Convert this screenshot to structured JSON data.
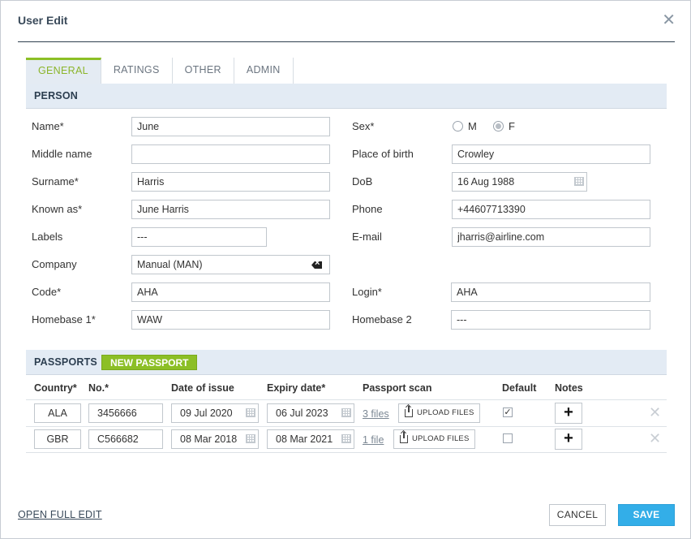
{
  "dialog": {
    "title": "User Edit",
    "close": "✕"
  },
  "tabs": [
    "GENERAL",
    "RATINGS",
    "OTHER",
    "ADMIN"
  ],
  "person": {
    "section": "PERSON",
    "left": [
      {
        "label": "Name*",
        "value": "June"
      },
      {
        "label": "Middle name",
        "value": ""
      },
      {
        "label": "Surname*",
        "value": "Harris"
      },
      {
        "label": "Known as*",
        "value": "June Harris"
      },
      {
        "label": "Labels",
        "value": "---"
      },
      {
        "label": "Company",
        "value": "Manual (MAN)"
      },
      {
        "label": "Code*",
        "value": "AHA"
      },
      {
        "label": "Homebase 1*",
        "value": "WAW"
      }
    ],
    "sex": {
      "label": "Sex*",
      "options": [
        "M",
        "F"
      ],
      "selected": "F"
    },
    "right": [
      {
        "label": "Place of birth",
        "value": "Crowley"
      },
      {
        "label": "DoB",
        "value": "16 Aug 1988"
      },
      {
        "label": "Phone",
        "value": "+44607713390"
      },
      {
        "label": "E-mail",
        "value": "jharris@airline.com"
      },
      {
        "label": "Login*",
        "value": "AHA"
      },
      {
        "label": "Homebase 2",
        "value": "---"
      }
    ]
  },
  "passports": {
    "section": "PASSPORTS",
    "new_button": "NEW PASSPORT",
    "columns": [
      "Country*",
      "No.*",
      "Date of issue",
      "Expiry date*",
      "Passport scan",
      "Default",
      "Notes"
    ],
    "rows": [
      {
        "country": "ALA",
        "number": "3456666",
        "issue": "09 Jul 2020",
        "expiry": "06 Jul 2023",
        "files": "3 files",
        "upload": "UPLOAD FILES",
        "default": true
      },
      {
        "country": "GBR",
        "number": "C566682",
        "issue": "08 Mar 2018",
        "expiry": "08 Mar 2021",
        "files": "1 file",
        "upload": "UPLOAD FILES",
        "default": false
      }
    ],
    "plus": "+",
    "delete": "✕"
  },
  "footer": {
    "open_full_edit": "OPEN FULL EDIT",
    "cancel": "CANCEL",
    "save": "SAVE"
  }
}
